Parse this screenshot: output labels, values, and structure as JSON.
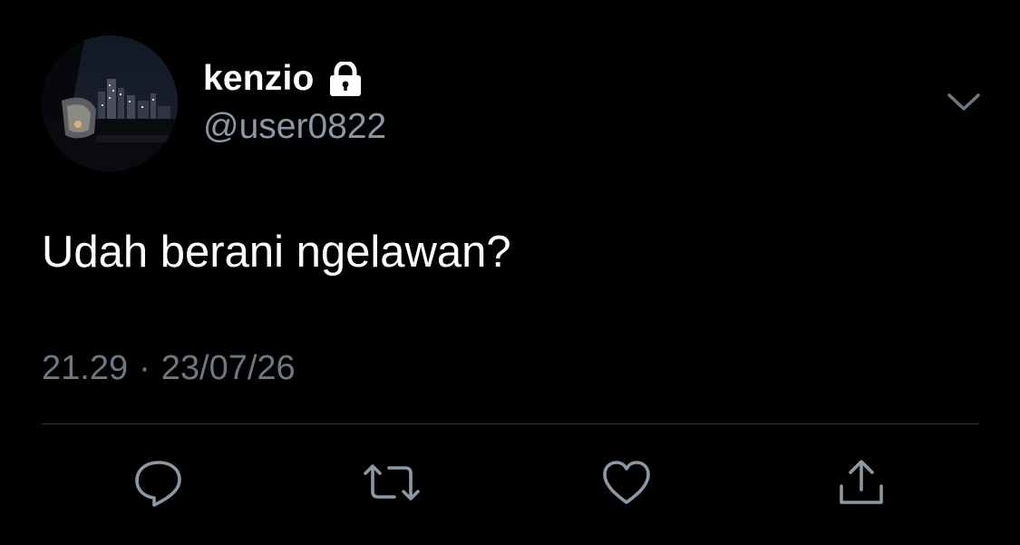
{
  "tweet": {
    "display_name": "kenzio",
    "handle": "@user0822",
    "text": "Udah berani ngelawan?",
    "time": "21.29",
    "separator": "·",
    "date": "23/07/26",
    "protected": true
  },
  "icons": {
    "lock": "lock-icon",
    "menu": "chevron-down-icon",
    "reply": "reply-icon",
    "retweet": "retweet-icon",
    "like": "heart-icon",
    "share": "share-icon"
  },
  "colors": {
    "background": "#000000",
    "primary_text": "#ffffff",
    "secondary_text": "#8b98a5",
    "icon": "#8b98a5",
    "divider": "#2f3336"
  }
}
